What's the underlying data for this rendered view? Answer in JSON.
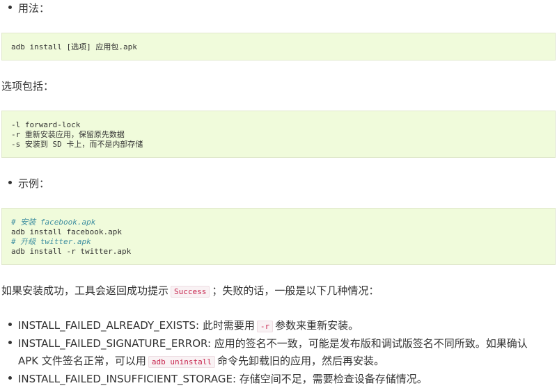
{
  "usage_heading": "用法：",
  "usage_code": [
    "adb install [选项] 应用包.apk"
  ],
  "options_heading": "选项包括：",
  "options_code": [
    "-l forward-lock",
    "-r 重新安装应用，保留原先数据",
    "-s 安装到 SD 卡上，而不是内部存储"
  ],
  "example_heading": "示例：",
  "example_code": [
    {
      "text": "# 安装 facebook.apk",
      "comment": true
    },
    {
      "text": "adb install facebook.apk",
      "comment": false
    },
    {
      "text": "# 升级 twitter.apk",
      "comment": true
    },
    {
      "text": "adb install -r twitter.apk",
      "comment": false
    }
  ],
  "result_para": {
    "before": "如果安装成功，工具会返回成功提示",
    "code": "Success",
    "after": "；失败的话，一般是以下几种情况："
  },
  "errors": {
    "item1": {
      "name": "INSTALL_FAILED_ALREADY_EXISTS: 此时需要用",
      "code": "-r",
      "after": "参数来重新安装。"
    },
    "item2": {
      "line1": "INSTALL_FAILED_SIGNATURE_ERROR: 应用的签名不一致，可能是发布版和调试版签名不同所致。如果确认",
      "line2_before": "APK 文件签名正常，可以用",
      "code": "adb uninstall",
      "line2_after": "命令先卸载旧的应用，然后再安装。"
    },
    "item3": {
      "text": "INSTALL_FAILED_INSUFFICIENT_STORAGE: 存储空间不足，需要检查设备存储情况。"
    }
  }
}
